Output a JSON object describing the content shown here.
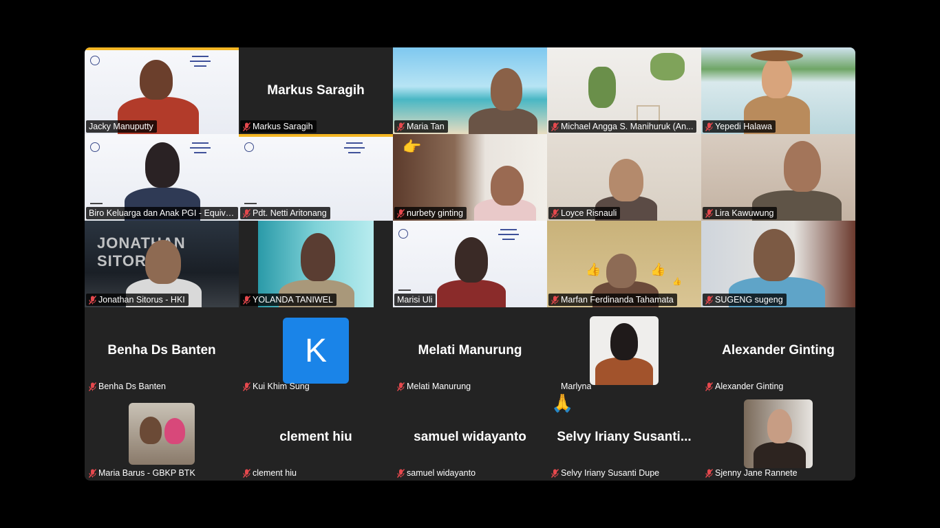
{
  "meeting": {
    "tiles": [
      {
        "name": "Jacky Manuputty",
        "mic": false
      },
      {
        "name": "Markus Saragih",
        "center": "Markus Saragih",
        "mic": true
      },
      {
        "name": "Maria Tan",
        "mic": true
      },
      {
        "name": "Michael Angga S. Manihuruk (An...",
        "mic": true
      },
      {
        "name": "Yepedi Halawa",
        "mic": true
      },
      {
        "name": "Biro Keluarga dan Anak PGI - Equiva...",
        "mic": false
      },
      {
        "name": "Pdt. Netti Aritonang",
        "mic": true
      },
      {
        "name": "nurbety ginting",
        "mic": true
      },
      {
        "name": "Loyce Risnauli",
        "mic": true
      },
      {
        "name": "Lira Kawuwung",
        "mic": true
      },
      {
        "name": "Jonathan Sitorus - HKI",
        "mic": true
      },
      {
        "name": "YOLANDA TANIWEL",
        "mic": true
      },
      {
        "name": "Marisi Uli",
        "mic": false
      },
      {
        "name": "Marfan Ferdinanda Tahamata",
        "mic": true
      },
      {
        "name": "SUGENG sugeng",
        "mic": true
      },
      {
        "name": "Benha Ds Banten",
        "center": "Benha Ds Banten",
        "mic": true
      },
      {
        "name": "Kui Khim Sung",
        "avatar": "K",
        "mic": true
      },
      {
        "name": "Melati Manurung",
        "center": "Melati Manurung",
        "mic": true
      },
      {
        "name": "Marlyna",
        "mic": false
      },
      {
        "name": "Alexander Ginting",
        "center": "Alexander Ginting",
        "mic": true
      },
      {
        "name": "Maria Barus - GBKP BTK",
        "mic": true
      },
      {
        "name": "clement hiu",
        "center": "clement hiu",
        "mic": true
      },
      {
        "name": "samuel widayanto",
        "center": "samuel widayanto",
        "mic": true
      },
      {
        "name": "Selvy Iriany Susanti Dupe",
        "center": "Selvy Iriany Susanti...",
        "mic": true
      },
      {
        "name": "Sjenny Jane Rannete",
        "mic": true
      }
    ],
    "active_speaker_index": 5,
    "reactions": {
      "thumbs": "👍",
      "pray": "🙏",
      "wave": "👉"
    },
    "background_text": {
      "jonathan": "JONATHAN SITORUS"
    },
    "accent_color": "#22c55e",
    "avatar_color": "#1a84e8"
  }
}
